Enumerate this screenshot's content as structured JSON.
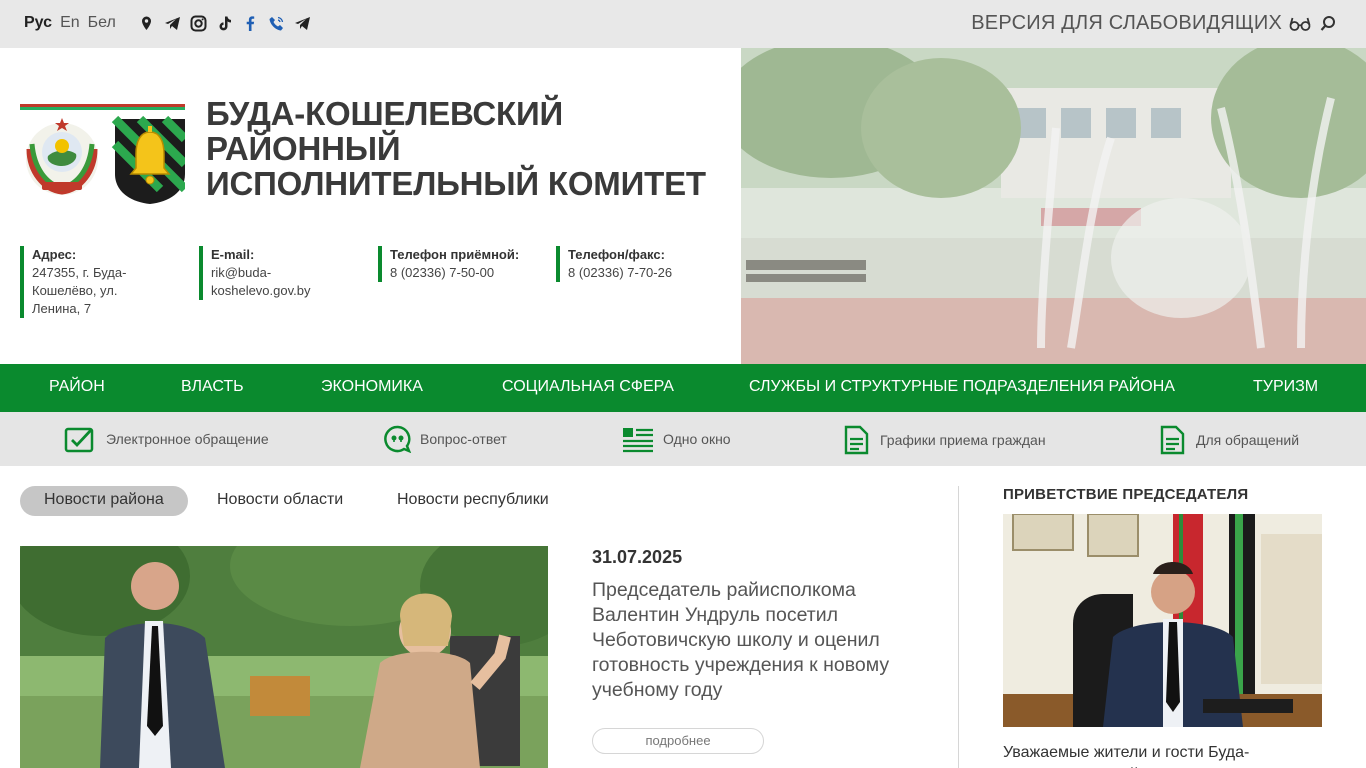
{
  "topbar": {
    "languages": [
      "Рус",
      "En",
      "Бел"
    ],
    "social_icons": [
      "location-icon",
      "telegram-icon",
      "instagram-icon",
      "tiktok-icon",
      "facebook-icon",
      "viber-icon",
      "telegram-icon"
    ],
    "accessibility_label": "ВЕРСИЯ ДЛЯ СЛАБОВИДЯЩИХ"
  },
  "header": {
    "title_lines": [
      "БУДА-КОШЕЛЕВСКИЙ",
      "РАЙОННЫЙ",
      "ИСПОЛНИТЕЛЬНЫЙ КОМИТЕТ"
    ],
    "contacts": [
      {
        "label": "Адрес:",
        "value_lines": [
          "247355, г. Буда-",
          "Кошелёво, ул.",
          "Ленина, 7"
        ]
      },
      {
        "label": "E-mail:",
        "value_lines": [
          "rik@buda-",
          "koshelevo.gov.by"
        ]
      },
      {
        "label": "Телефон приёмной:",
        "value_lines": [
          "8 (02336) 7-50-00"
        ]
      },
      {
        "label": "Телефон/факс:",
        "value_lines": [
          "8 (02336) 7-70-26"
        ]
      }
    ]
  },
  "nav": {
    "items": [
      "РАЙОН",
      "ВЛАСТЬ",
      "ЭКОНОМИКА",
      "СОЦИАЛЬНАЯ СФЕРА",
      "СЛУЖБЫ И СТРУКТУРНЫЕ ПОДРАЗДЕЛЕНИЯ РАЙОНА",
      "ТУРИЗМ"
    ]
  },
  "quick_links": [
    {
      "label": "Электронное обращение",
      "icon": "edit-check-icon"
    },
    {
      "label": "Вопрос-ответ",
      "icon": "quote-bubble-icon"
    },
    {
      "label": "Одно окно",
      "icon": "list-icon"
    },
    {
      "label": "Графики приема граждан",
      "icon": "document-icon"
    },
    {
      "label": "Для обращений",
      "icon": "document-icon"
    }
  ],
  "news": {
    "tabs": [
      "Новости района",
      "Новости области",
      "Новости республики"
    ],
    "active_tab": "Новости района",
    "date": "31.07.2025",
    "title": "Председатель райисполкома Валентин Ундруль посетил Чеботовичскую школу и оценил готовность учреждения к новому учебному году",
    "more_label": "подробнее"
  },
  "greeting": {
    "heading": "ПРИВЕТСТВИЕ ПРЕДСЕДАТЕЛЯ",
    "text": "Уважаемые жители и гости Буда-Кошелевского района! Сердечно"
  },
  "colors": {
    "brand_green": "#0a8a2e",
    "topbar_bg": "#e8e8e8",
    "quick_bg": "#e5e5e5"
  }
}
